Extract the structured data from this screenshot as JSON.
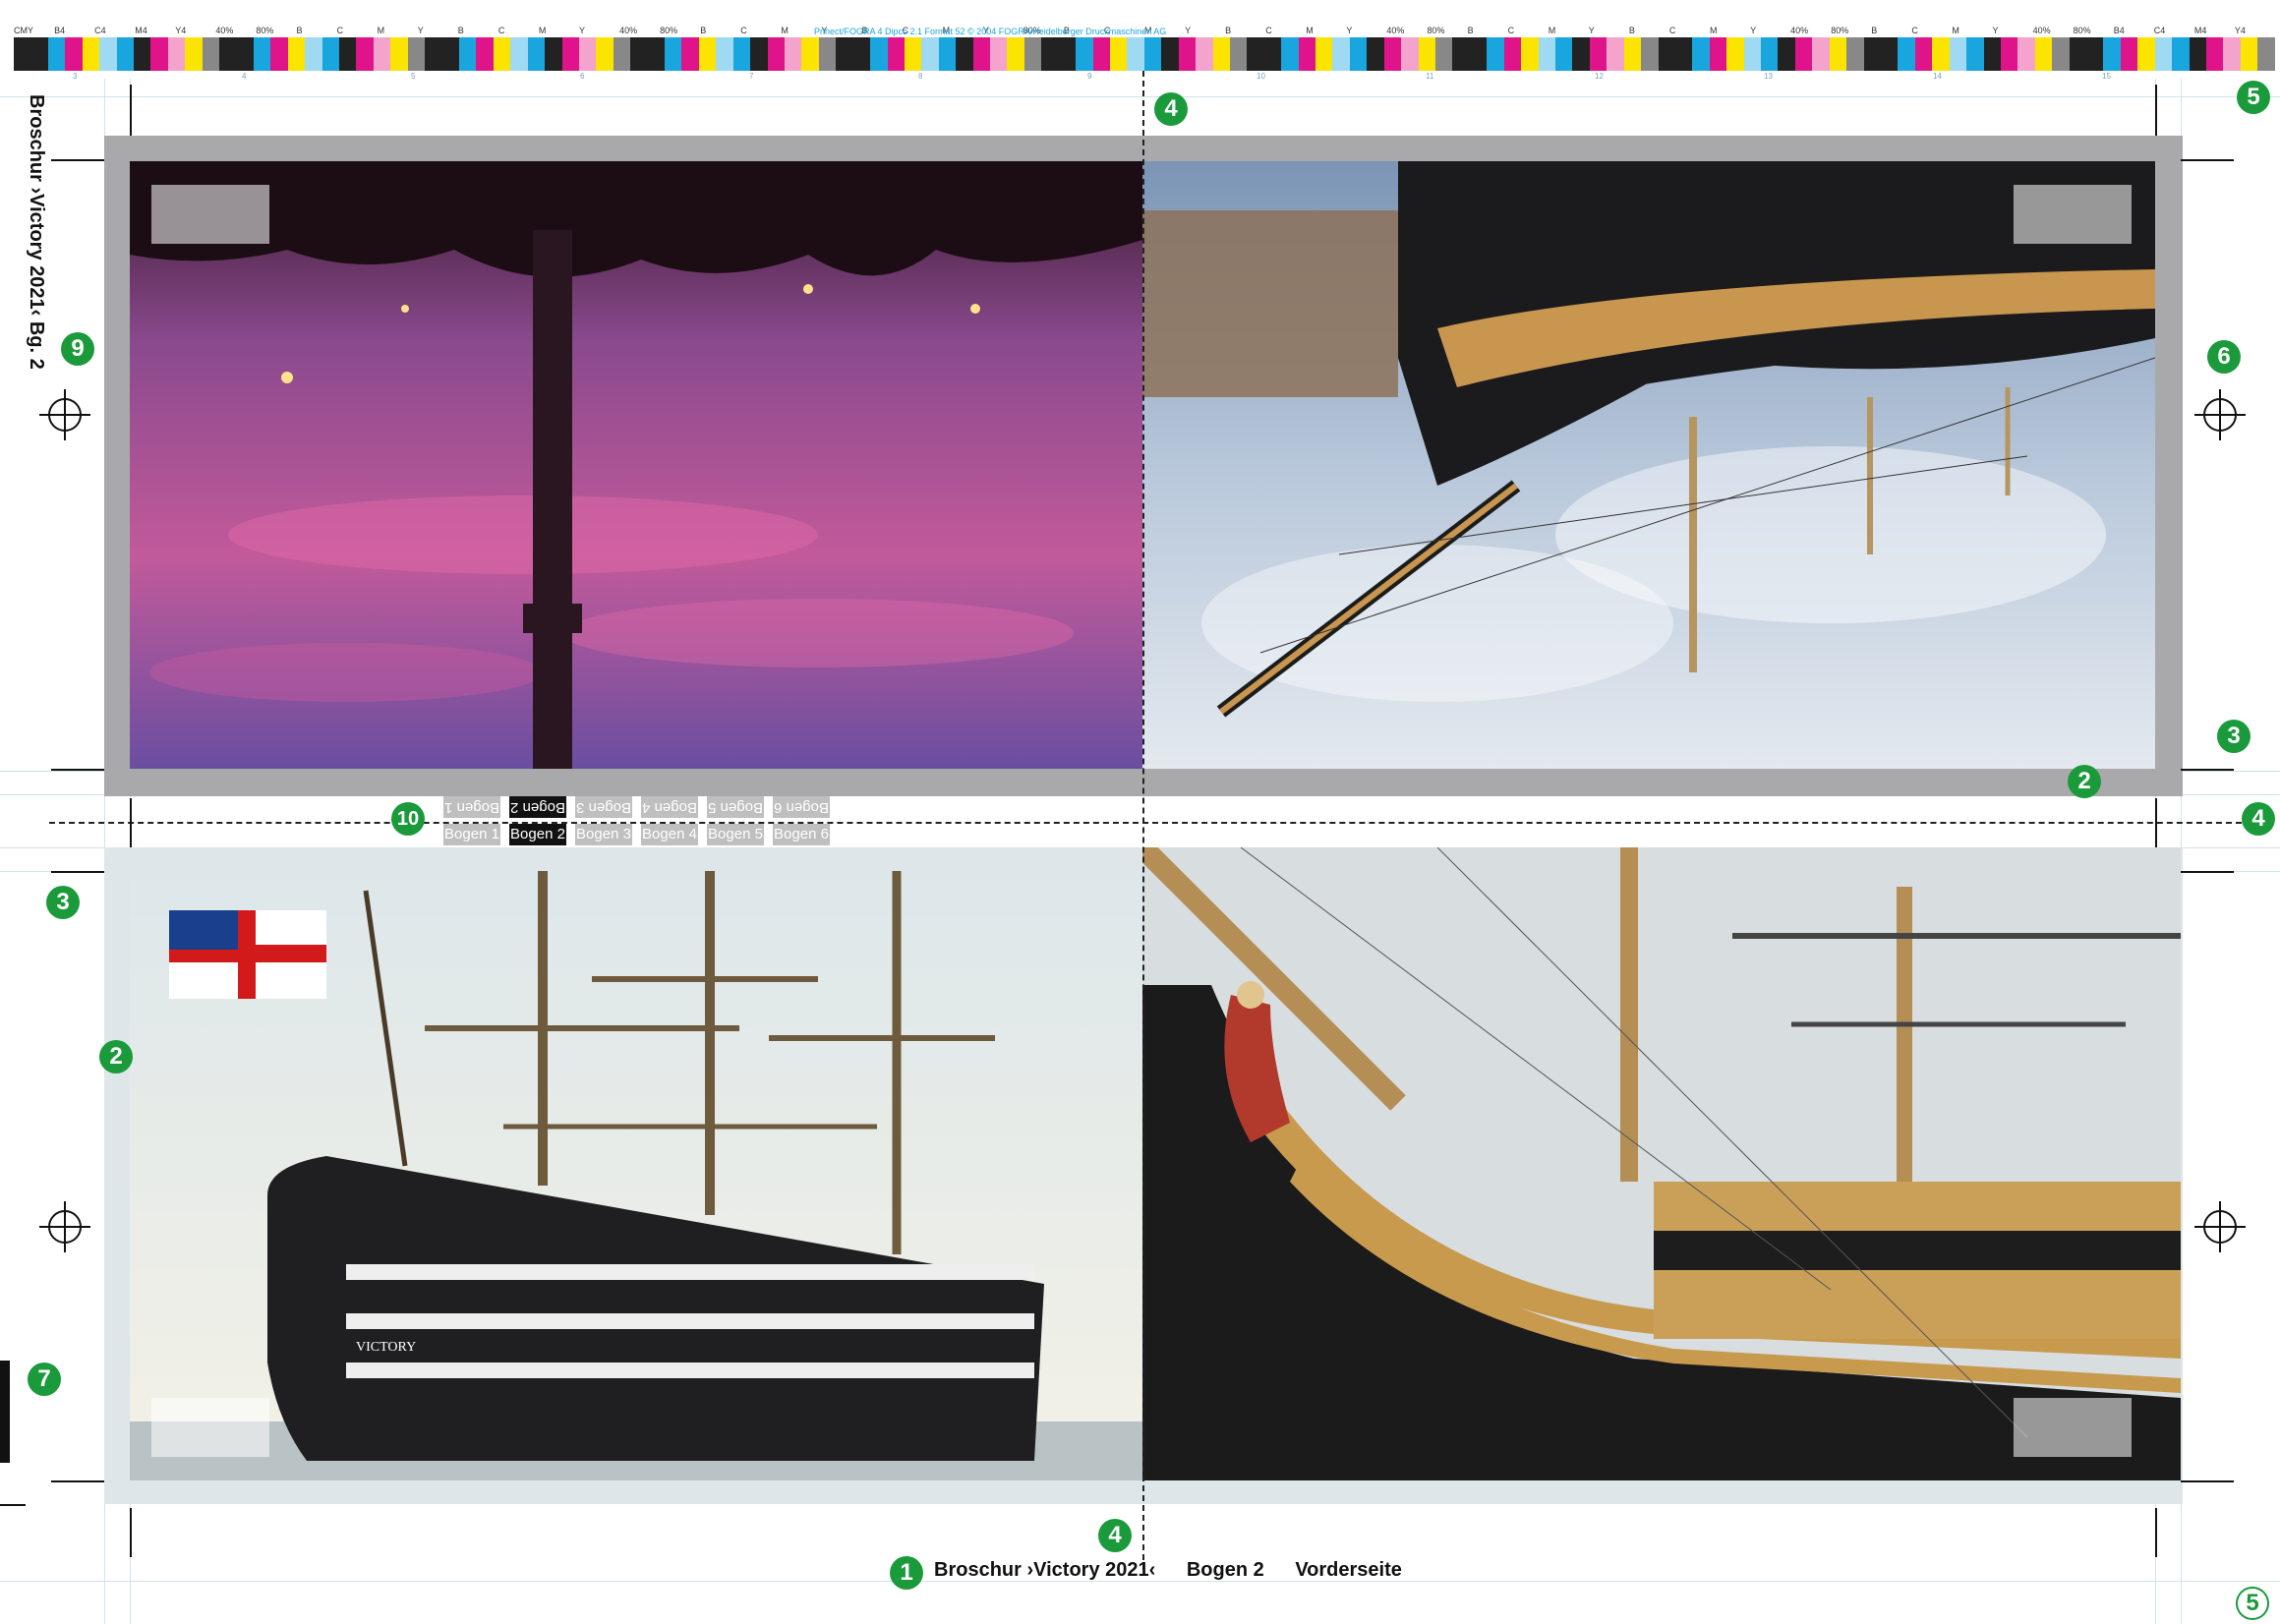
{
  "colorbar": {
    "labels": [
      "CMY",
      "B4",
      "C4",
      "M4",
      "Y4",
      "40%",
      "80%",
      "B",
      "C",
      "M",
      "Y",
      "B",
      "C",
      "M",
      "Y",
      "40%",
      "80%",
      "B",
      "C",
      "M",
      "Y",
      "B",
      "C",
      "M",
      "Y",
      "80%",
      "B",
      "C",
      "M",
      "Y",
      "B",
      "C",
      "M",
      "Y",
      "40%",
      "80%",
      "B",
      "C",
      "M",
      "Y",
      "B",
      "C",
      "M",
      "Y",
      "40%",
      "80%",
      "B",
      "C",
      "M",
      "Y",
      "40%",
      "80%",
      "B4",
      "C4",
      "M4",
      "Y4"
    ],
    "caption": "Prinect/FOGRA 4 Dipco 2.1 Format 52 © 2004 FOGRA/Heidelberger Druckmaschinen AG",
    "zone_numbers": [
      "3",
      "4",
      "5",
      "6",
      "7",
      "8",
      "9",
      "10",
      "11",
      "12",
      "13",
      "14",
      "15"
    ],
    "colors": {
      "black": "#222222",
      "cyan": "#19a6df",
      "magenta": "#e0148a",
      "yellow": "#fbe400",
      "lightcyan": "#9fd9f2",
      "pink": "#f4a4cc",
      "lightyellow": "#fff5a0",
      "gray": "#888888"
    }
  },
  "side_label": "Broschur ›Victory 2021‹   Bg. 2",
  "badges": {
    "b1": "1",
    "b2a": "2",
    "b2b": "2",
    "b3a": "3",
    "b3b": "3",
    "b4a": "4",
    "b4b": "4",
    "b4c": "4",
    "b5a": "5",
    "b5b": "5",
    "b6": "6",
    "b7": "7",
    "b9": "9",
    "b10": "10"
  },
  "bogen_tabs": {
    "top": [
      "Bogen 1",
      "Bogen 2",
      "Bogen 3",
      "Bogen 4",
      "Bogen 5",
      "Bogen 6"
    ],
    "bottom": [
      "Bogen 1",
      "Bogen 2",
      "Bogen 3",
      "Bogen 4",
      "Bogen 5",
      "Bogen 6"
    ],
    "active_index": 1
  },
  "footer": {
    "title": "Broschur ›Victory 2021‹",
    "sheet": "Bogen 2",
    "side": "Vorderseite"
  },
  "ship_nameplate": "VICTORY",
  "accent": "#1a9a3a"
}
